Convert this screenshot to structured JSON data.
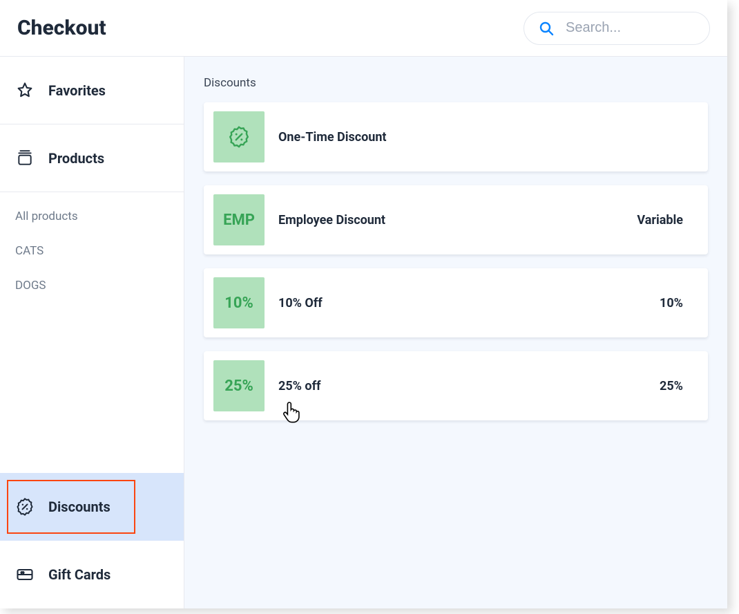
{
  "header": {
    "title": "Checkout",
    "search_placeholder": "Search..."
  },
  "sidebar": {
    "favorites": {
      "label": "Favorites"
    },
    "products": {
      "label": "Products"
    },
    "product_subitems": [
      {
        "label": "All products"
      },
      {
        "label": "CATS"
      },
      {
        "label": "DOGS"
      }
    ],
    "discounts": {
      "label": "Discounts",
      "active": true,
      "highlighted": true
    },
    "giftcards": {
      "label": "Gift Cards"
    }
  },
  "main": {
    "heading": "Discounts",
    "items": [
      {
        "badge_kind": "discount-icon",
        "badge_text": "",
        "title": "One-Time Discount",
        "meta": ""
      },
      {
        "badge_kind": "text",
        "badge_text": "EMP",
        "title": "Employee Discount",
        "meta": "Variable"
      },
      {
        "badge_kind": "text",
        "badge_text": "10%",
        "title": "10% Off",
        "meta": "10%"
      },
      {
        "badge_kind": "text",
        "badge_text": "25%",
        "title": "25% off",
        "meta": "25%"
      }
    ]
  },
  "colors": {
    "accent_blue": "#0a84ff",
    "badge_green_bg": "#b0e1bb",
    "badge_green_fg": "#37a456",
    "sidebar_active_bg": "#d7e5fb",
    "highlight_border": "#fb4510",
    "main_bg": "#f4f8fe"
  }
}
